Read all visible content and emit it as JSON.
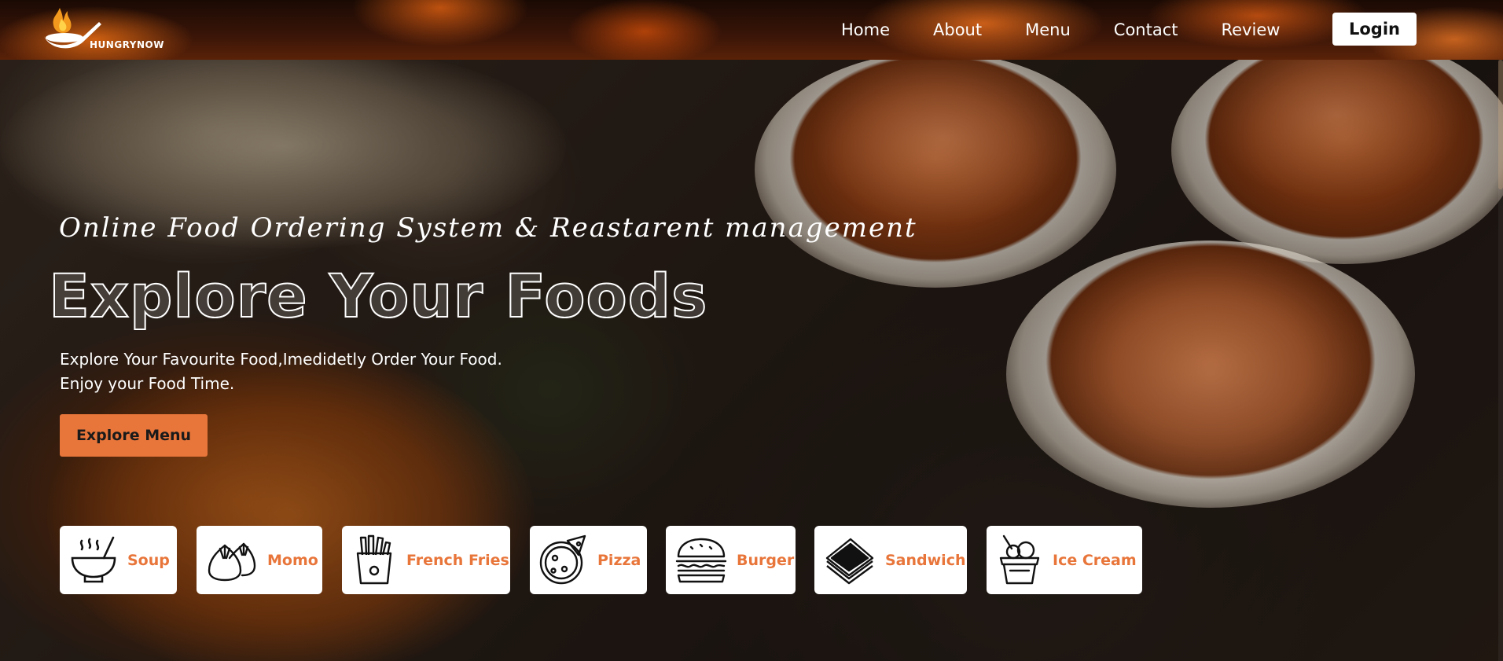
{
  "brand": {
    "name": "HUNGRYNOW",
    "accent_color": "#e8753a"
  },
  "nav": {
    "links": [
      {
        "label": "Home"
      },
      {
        "label": "About"
      },
      {
        "label": "Menu"
      },
      {
        "label": "Contact"
      },
      {
        "label": "Review"
      }
    ],
    "login_label": "Login"
  },
  "hero": {
    "tagline": "Online Food Ordering System & Reastarent management",
    "headline": "Explore Your Foods",
    "description_line1": "Explore Your Favourite Food,Imedidetly Order Your Food.",
    "description_line2": "Enjoy your Food Time.",
    "cta_label": "Explore Menu"
  },
  "categories": [
    {
      "label": "Soup",
      "icon": "soup-bowl-icon"
    },
    {
      "label": "Momo",
      "icon": "momo-dumpling-icon"
    },
    {
      "label": "French Fries",
      "icon": "french-fries-icon"
    },
    {
      "label": "Pizza",
      "icon": "pizza-icon"
    },
    {
      "label": "Burger",
      "icon": "burger-icon"
    },
    {
      "label": "Sandwich",
      "icon": "sandwich-icon"
    },
    {
      "label": "Ice Cream",
      "icon": "ice-cream-icon"
    }
  ]
}
